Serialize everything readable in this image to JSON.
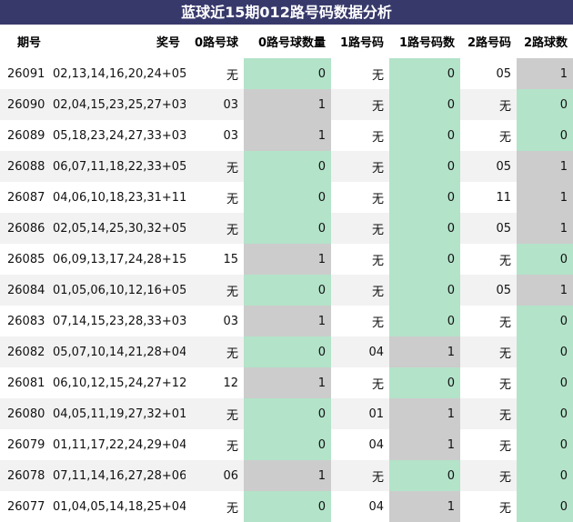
{
  "title": "蓝球近15期012路号码数据分析",
  "colors": {
    "header_bg": "#38396b",
    "green": "#b3e3c9",
    "gray": "#cccccc",
    "stripe": "#f2f2f2"
  },
  "columns": [
    "期号",
    "奖号",
    "0路号球",
    "0路号球数量",
    "1路号码",
    "1路号码数",
    "2路号码",
    "2路球数"
  ],
  "rows": [
    [
      "26091",
      "02,13,14,16,20,24+05",
      "无",
      "0",
      "无",
      "0",
      "05",
      "1"
    ],
    [
      "26090",
      "02,04,15,23,25,27+03",
      "03",
      "1",
      "无",
      "0",
      "无",
      "0"
    ],
    [
      "26089",
      "05,18,23,24,27,33+03",
      "03",
      "1",
      "无",
      "0",
      "无",
      "0"
    ],
    [
      "26088",
      "06,07,11,18,22,33+05",
      "无",
      "0",
      "无",
      "0",
      "05",
      "1"
    ],
    [
      "26087",
      "04,06,10,18,23,31+11",
      "无",
      "0",
      "无",
      "0",
      "11",
      "1"
    ],
    [
      "26086",
      "02,05,14,25,30,32+05",
      "无",
      "0",
      "无",
      "0",
      "05",
      "1"
    ],
    [
      "26085",
      "06,09,13,17,24,28+15",
      "15",
      "1",
      "无",
      "0",
      "无",
      "0"
    ],
    [
      "26084",
      "01,05,06,10,12,16+05",
      "无",
      "0",
      "无",
      "0",
      "05",
      "1"
    ],
    [
      "26083",
      "07,14,15,23,28,33+03",
      "03",
      "1",
      "无",
      "0",
      "无",
      "0"
    ],
    [
      "26082",
      "05,07,10,14,21,28+04",
      "无",
      "0",
      "04",
      "1",
      "无",
      "0"
    ],
    [
      "26081",
      "06,10,12,15,24,27+12",
      "12",
      "1",
      "无",
      "0",
      "无",
      "0"
    ],
    [
      "26080",
      "04,05,11,19,27,32+01",
      "无",
      "0",
      "01",
      "1",
      "无",
      "0"
    ],
    [
      "26079",
      "01,11,17,22,24,29+04",
      "无",
      "0",
      "04",
      "1",
      "无",
      "0"
    ],
    [
      "26078",
      "07,11,14,16,27,28+06",
      "06",
      "1",
      "无",
      "0",
      "无",
      "0"
    ],
    [
      "26077",
      "01,04,05,14,18,25+04",
      "无",
      "0",
      "04",
      "1",
      "无",
      "0"
    ]
  ]
}
